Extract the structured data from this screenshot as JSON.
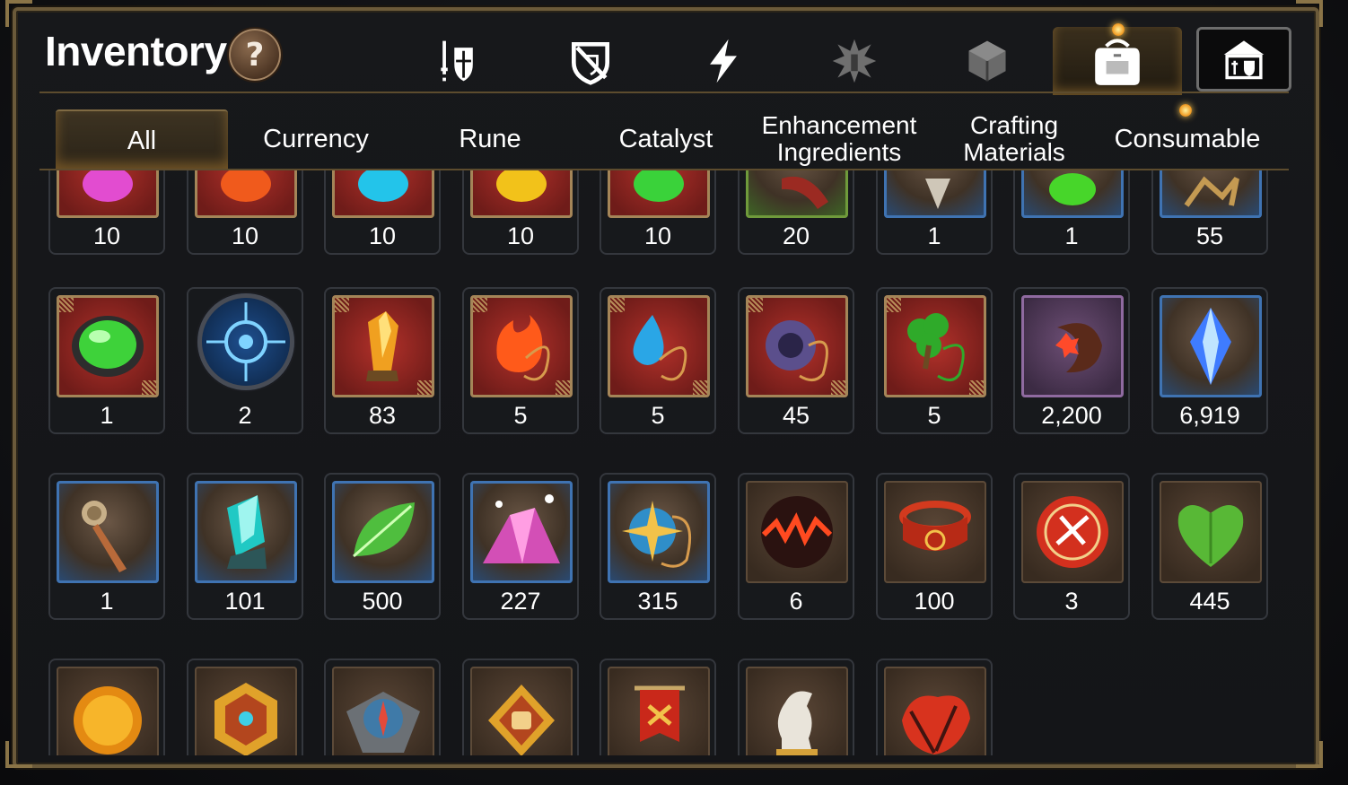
{
  "header": {
    "title": "Inventory",
    "help_label": "?"
  },
  "top_tabs": [
    {
      "icon": "gear-sword-shield-icon"
    },
    {
      "icon": "artifact-shield-icon"
    },
    {
      "icon": "lightning-icon"
    },
    {
      "icon": "spirit-crest-icon"
    },
    {
      "icon": "cube-icon"
    },
    {
      "icon": "backpack-icon",
      "active": true
    },
    {
      "icon": "shop-icon"
    }
  ],
  "category_tabs": [
    {
      "label": "All",
      "active": true
    },
    {
      "label": "Currency"
    },
    {
      "label": "Rune"
    },
    {
      "label": "Catalyst"
    },
    {
      "label_line1": "Enhancement",
      "label_line2": "Ingredients"
    },
    {
      "label_line1": "Crafting",
      "label_line2": "Materials"
    },
    {
      "label": "Consumable"
    }
  ],
  "items": {
    "row1": [
      "10",
      "10",
      "10",
      "10",
      "10",
      "20",
      "1",
      "1",
      "55"
    ],
    "row2": [
      "1",
      "2",
      "83",
      "5",
      "5",
      "45",
      "5",
      "2,200",
      "6,919"
    ],
    "row3": [
      "1",
      "101",
      "500",
      "227",
      "315",
      "6",
      "100",
      "3",
      "445"
    ],
    "row4_icons": [
      "sun-medallion-icon",
      "golden-hexagon-icon",
      "compass-stone-icon",
      "fist-emblem-icon",
      "war-banner-icon",
      "knight-chess-icon",
      "autumn-leaf-icon"
    ]
  },
  "colors": {
    "frame": "#6b5a3a",
    "accent_gold": "#f2a12a",
    "text": "#ffffff"
  }
}
